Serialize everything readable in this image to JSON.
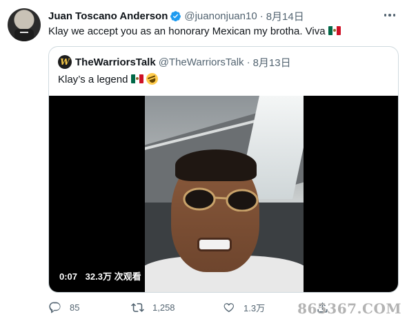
{
  "tweet": {
    "author_name": "Juan Toscano Anderson",
    "handle": "@juanonjuan10",
    "separator": "·",
    "date": "8月14日",
    "text": "Klay we accept you as an honorary Mexican my brotha. Viva",
    "emoji": [
      "mexico-flag"
    ]
  },
  "quoted": {
    "logo_letter": "W",
    "author_name": "TheWarriorsTalk",
    "handle": "@TheWarriorsTalk",
    "separator": "·",
    "date": "8月13日",
    "text": "Klay’s a legend",
    "emoji": [
      "mexico-flag",
      "rolling-on-floor-laughing"
    ],
    "video": {
      "elapsed": "0:07",
      "views": "32.3万 次观看"
    }
  },
  "actions": {
    "reply_count": "85",
    "retweet_count": "1,258",
    "like_count": "1.3万",
    "share_count": ""
  },
  "watermark": "865367.COM",
  "colors": {
    "text": "#0f1419",
    "secondary": "#536471",
    "verified": "#1d9bf0",
    "border": "#cfd9de"
  }
}
